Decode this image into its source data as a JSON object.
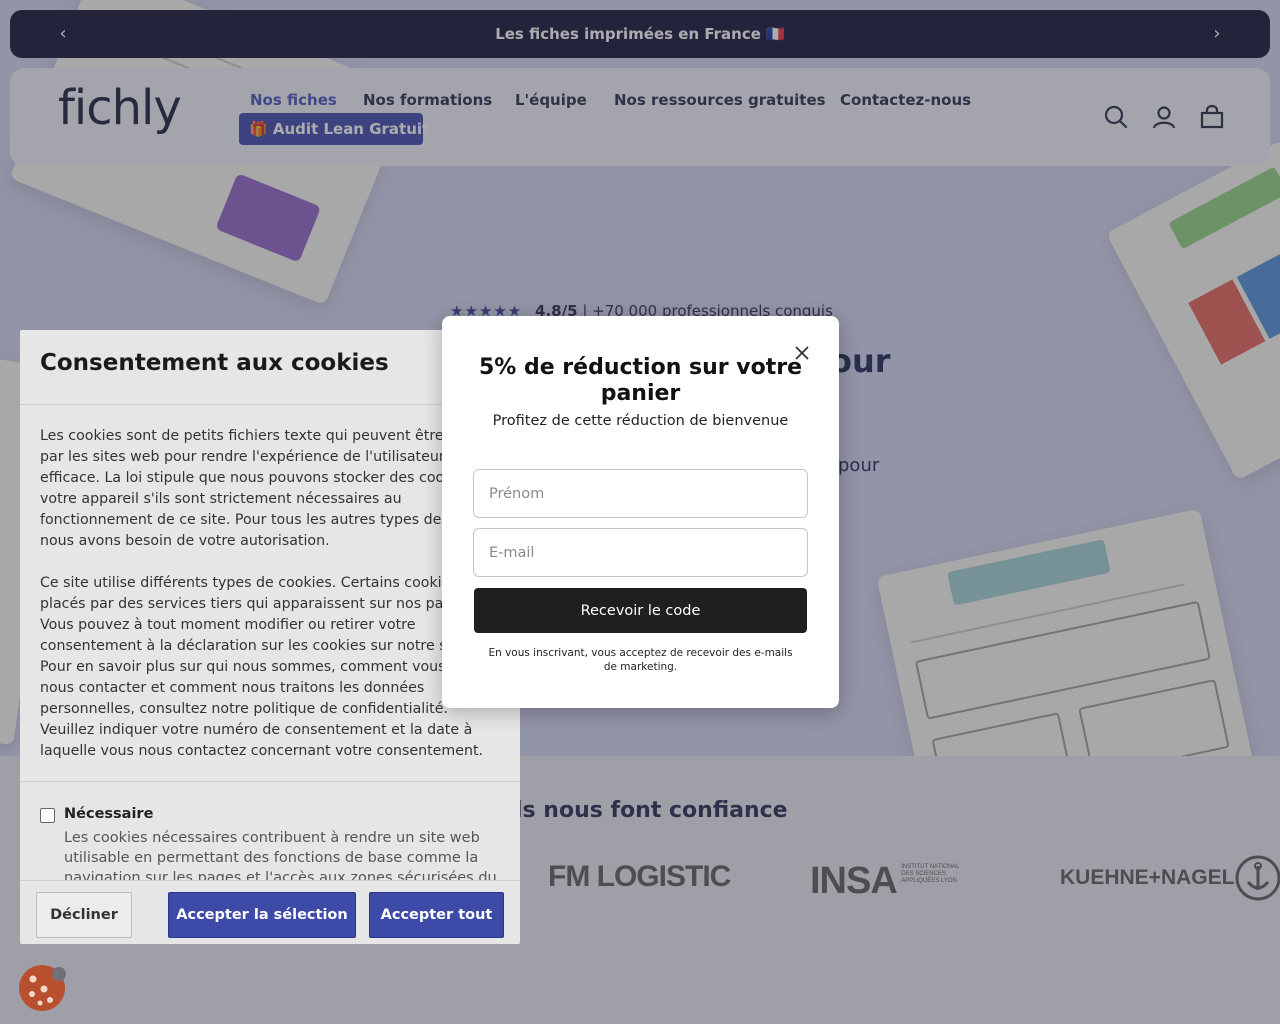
{
  "announcement": {
    "text": "Les fiches imprimées en France 🇫🇷",
    "prev_icon": "chevron-left-icon",
    "next_icon": "chevron-right-icon"
  },
  "header": {
    "logo": "fichly",
    "nav": [
      "Nos fiches",
      "Nos formations",
      "L'équipe",
      "Nos ressources gratuites",
      "Contactez-nous"
    ],
    "active_nav": "Nos fiches",
    "audit_button": "🎁 Audit Lean Gratuit",
    "icons": [
      "search-icon",
      "account-icon",
      "cart-icon"
    ]
  },
  "hero": {
    "stars": "★★★★★",
    "rating": "4.8/5",
    "rating_text": "| +70 000 professionnels conquis",
    "title_fragment": "our",
    "subtitle_fragment": "pour"
  },
  "trust": {
    "title_fragment": "ls nous font confiance",
    "brands": [
      "FM LOGISTIC",
      "INSA",
      "KUEHNE+NAGEL"
    ],
    "insa_caption": "INSTITUT NATIONAL DES SCIENCES APPLIQUÉES LYON"
  },
  "cookie_banner": {
    "title": "Consentement aux cookies",
    "paragraph1_lines": [
      "Les cookies sont de petits fichiers texte qui peuvent être utilisés",
      "par les sites web pour rendre l'expérience de l'utilisateur plus",
      "efficace. La loi stipule que nous pouvons stocker des cookies sur",
      "votre appareil s'ils sont strictement nécessaires au",
      "fonctionnement de ce site. Pour tous les autres types de cookies,",
      "nous avons besoin de votre autorisation."
    ],
    "paragraph2_lines": [
      "Ce site utilise différents types de cookies. Certains cookies sont",
      "placés par des services tiers qui apparaissent sur nos pages.",
      "Vous pouvez à tout moment modifier ou retirer votre",
      "consentement à la déclaration sur les cookies sur notre site web.",
      "Pour en savoir plus sur qui nous sommes, comment vous pouvez",
      "nous contacter et comment nous traitons les données",
      "personnelles, consultez notre politique de confidentialité.",
      "Veuillez indiquer votre numéro de consentement et la date à",
      "laquelle vous nous contactez concernant votre consentement."
    ],
    "necessary_label": "Nécessaire",
    "necessary_checked": false,
    "necessary_desc": "Les cookies nécessaires contribuent à rendre un site web utilisable en permettant des fonctions de base comme la navigation sur les pages et l'accès aux zones sécurisées du site web.",
    "buttons": {
      "decline": "Décliner",
      "accept_selection": "Accepter la sélection",
      "accept_all": "Accepter tout"
    }
  },
  "discount_modal": {
    "title": "5% de réduction sur votre panier",
    "subtitle": "Profitez de cette réduction de bienvenue",
    "firstname_placeholder": "Prénom",
    "firstname_value": "",
    "email_placeholder": "E-mail",
    "email_value": "",
    "submit_label": "Recevoir le code",
    "disclaimer": "En vous inscrivant, vous acceptez de recevoir des e-mails de marketing.",
    "close_icon": "close-icon"
  },
  "colors": {
    "announcement_bg": "#06092b",
    "brand_blue": "#3441a8",
    "hero_bg": "#cfd3ee",
    "submit_bg": "#1f1f1f"
  }
}
